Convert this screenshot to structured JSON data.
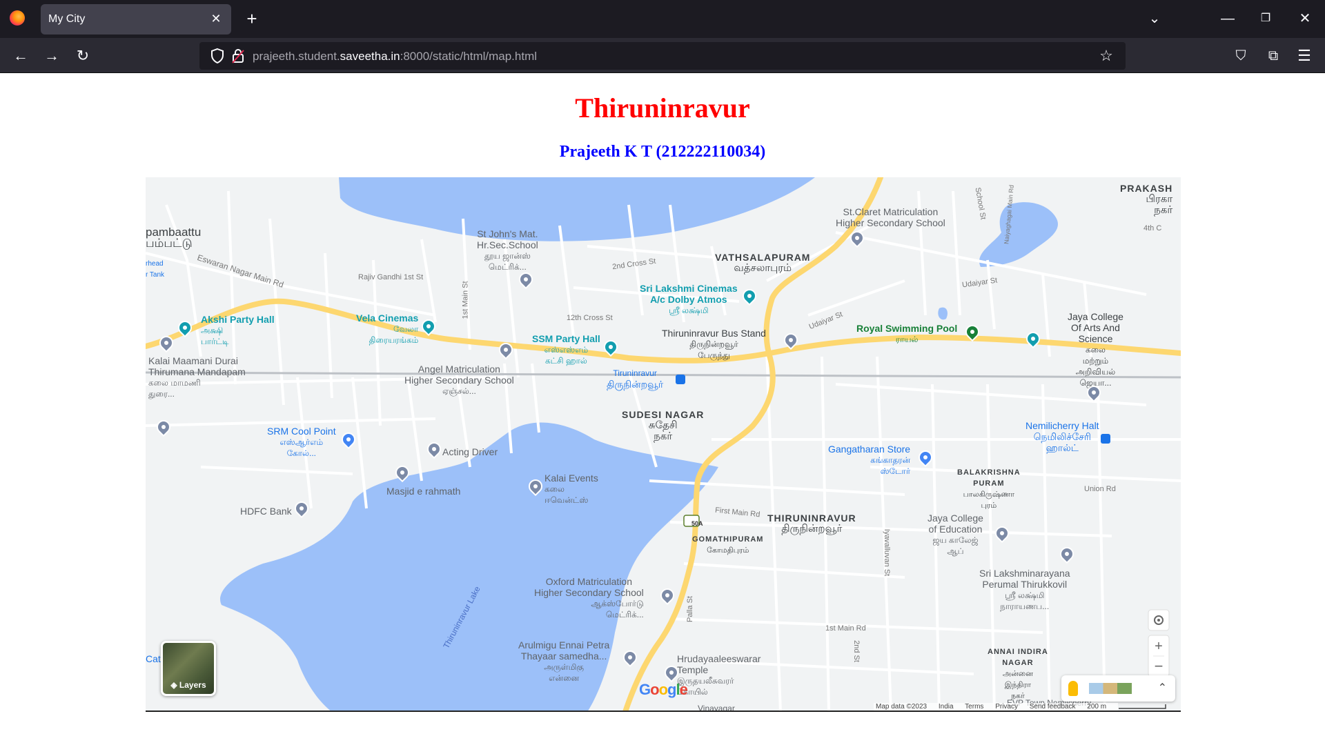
{
  "browser": {
    "tab_title": "My City",
    "url_prefix": "prajeeth.student.",
    "url_domain": "saveetha.in",
    "url_suffix": ":8000/static/html/map.html"
  },
  "page": {
    "title": "Thiruninravur",
    "subtitle": "Prajeeth K T (212222110034)"
  },
  "map": {
    "labels": {
      "vathsalapuram": "VATHSALAPURAM",
      "vathsalapuram_ta": "வத்சலாபுரம்",
      "sudesi_nagar": "SUDESI NAGAR",
      "sudesi_nagar_ta": "சுதேசி\nநகர்",
      "thiruninravur": "THIRUNINRAVUR",
      "thiruninravur_ta": "திருநின்றவூர்",
      "gomathipuram": "GOMATHIPURAM",
      "gomathipuram_ta": "கோமதிபுரம்",
      "balakrishna": "BALAKRISHNA\nPURAM",
      "balakrishna_ta": "பாலகிருஷ்ணா\nபுரம்",
      "annai_indira": "ANNAI INDIRA\nNAGAR",
      "annai_indira_ta": "அன்னை\nஇந்திரா\nநகர்",
      "prakash": "PRAKASH",
      "prakash_ta": "பிரகா\nநகர்",
      "pambaattu": "pambaattu",
      "pambaattu_ta": "பம்பட்டு",
      "st_johns": "St John's Mat.\nHr.Sec.School",
      "st_johns_ta": "தூய ஜான்ஸ்\nமெட்ரிக்...",
      "st_claret": "St.Claret Matriculation\nHigher Secondary School",
      "sri_lakshmi_cinemas": "Sri Lakshmi Cinemas\nA/c Dolby Atmos",
      "sri_lakshmi_cinemas_ta": "ஸ்ரீ லக்ஷ்மி",
      "bus_stand": "Thiruninravur Bus Stand",
      "bus_stand_ta": "திருநின்றவூர்\nபேருந்து",
      "royal_pool": "Royal Swimming Pool",
      "royal_pool_ta": "ராயல்",
      "jaya_college": "Jaya College\nOf Arts And\nScience",
      "jaya_college_ta": "கலை\nமற்றும்\nஅறிவியல்\nஜெயா...",
      "akshi": "Akshi Party Hall",
      "akshi_ta": "அக்ஷி\nபார்ட்டி",
      "vela": "Vela Cinemas",
      "vela_ta": "வேலா\nதிரையரங்கம்",
      "ssm": "SSM Party Hall",
      "ssm_ta": "எஸ்எஸ்எம்\nகட்சி ஹால்",
      "angel": "Angel Matriculation\nHigher Secondary School",
      "angel_ta": "ஏஞ்சல்...",
      "station": "Tiruninravur",
      "station_ta": "திருநின்றவூர்",
      "kalai_maamani": "Kalai Maamani Durai\nThirumana Mandapam",
      "kalai_maamani_ta": "கலை மாமணி\nதுரை...",
      "srm": "SRM Cool Point",
      "srm_ta": "எஸ்ஆர்எம்\nகோல்...",
      "acting_driver": "Acting Driver",
      "masjid": "Masjid e rahmath",
      "hdfc": "HDFC Bank",
      "kalai_events": "Kalai Events",
      "kalai_events_ta": "கலை\nஈவென்ட்ஸ்",
      "gangatharan": "Gangatharan Store",
      "gangatharan_ta": "கங்காதரன்\nஸ்டோர்",
      "nemilicherry": "Nemilicherry Halt",
      "nemilicherry_ta": "நெமிலிச்சேரி\nஹால்ட்",
      "jaya_edu": "Jaya College\nof Education",
      "jaya_edu_ta": "ஜய காலேஜ்\nஆப்",
      "perumal": "Sri Lakshminarayana\nPerumal Thirukkovil",
      "perumal_ta": "ஸ்ரீ லக்ஷ்மி\nநாராயணப...",
      "oxford": "Oxford Matriculation\nHigher Secondary School",
      "oxford_ta": "ஆக்ஸ்போர்டு\nமெட்ரிக்...",
      "arulmigu": "Arulmigu Ennai Petra\nThayaar samedha...",
      "arulmigu_ta": "அருள்மிகு\nஎன்னை",
      "hrudaya": "Hrudayaaleeswarar\nTemple",
      "hrudaya_ta": "இருதயலீசுவரர்\nகோயில்",
      "lake": "Thiruninravur Lake",
      "tank": "rhead\nr Tank",
      "cat": "Cat",
      "vinayagar": "Vinayagar",
      "evp": "EVP Town Nemilcherry",
      "highway": "50A"
    },
    "roads": {
      "eswaran": "Eswaran Nagar Main Rd",
      "rajiv": "Rajiv Gandhi 1st St",
      "cross2": "2nd Cross St",
      "cross12": "12th Cross St",
      "main1": "1st Main St",
      "udaiyar1": "Udaiyar St",
      "udaiyar2": "Udaiyar St",
      "school": "School St",
      "naiyaghagai": "Naiyaghagai Main Rd",
      "first_main": "First Main Rd",
      "palla": "Palla St",
      "union": "Union Rd",
      "iyavalluvan": "Iyavalluvan St",
      "main_rd1": "1st Main Rd",
      "second": "2nd St",
      "fourth": "4th C"
    },
    "layers_label": "Layers",
    "attribution": [
      "Map data ©2023",
      "India",
      "Terms",
      "Privacy",
      "Send feedback",
      "200 m"
    ],
    "colors": {
      "land": "#f1f3f4",
      "water": "#9cc0f9",
      "major_road": "#fdd770",
      "road": "#ffffff"
    }
  }
}
